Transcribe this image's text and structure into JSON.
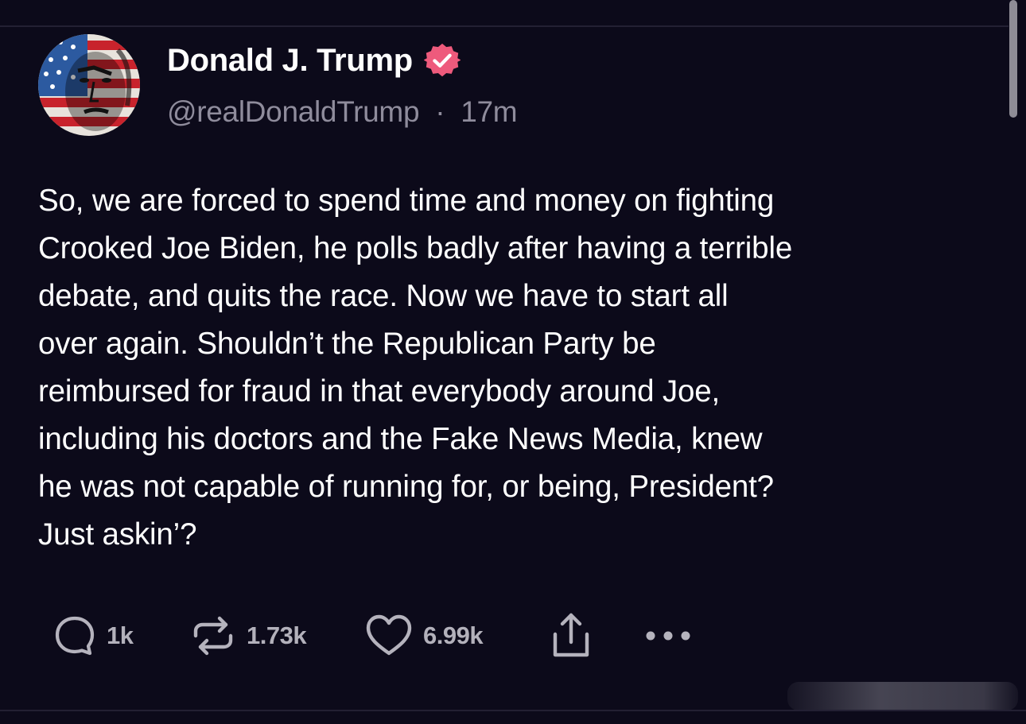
{
  "author": {
    "display_name": "Donald J. Trump",
    "handle": "@realDonaldTrump",
    "separator": "·",
    "timestamp": "17m",
    "verified": true
  },
  "post": {
    "lines": [
      "So, we are forced to spend time and money on fighting",
      "Crooked Joe Biden, he polls badly after having a terrible",
      "debate, and quits the race. Now we have to start all",
      "over again. Shouldn’t the Republican Party be",
      "reimbursed for fraud in that everybody around Joe,",
      "including his doctors and the Fake News Media, knew",
      "he was not capable of running for, or being, President?",
      "Just askin’?"
    ]
  },
  "actions": {
    "reply": {
      "icon": "speech-bubble-icon",
      "count": "1k"
    },
    "repost": {
      "icon": "repost-arrows-icon",
      "count": "1.73k"
    },
    "like": {
      "icon": "heart-icon",
      "count": "6.99k"
    },
    "share": {
      "icon": "share-upload-icon"
    },
    "more": {
      "icon": "ellipsis-icon"
    }
  },
  "colors": {
    "background": "#0c0a1a",
    "text_primary": "#ffffff",
    "text_secondary": "#8f8c9c",
    "action_gray": "#b3b1bb",
    "verified_badge": "#ee5a7c",
    "divider": "#232033"
  }
}
